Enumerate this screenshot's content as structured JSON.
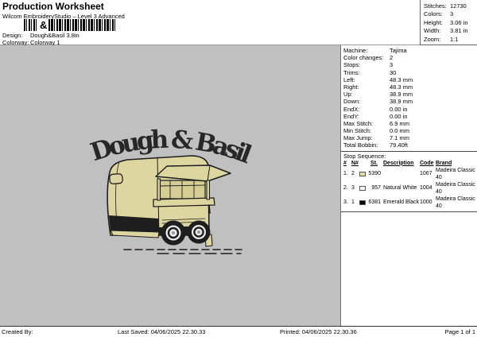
{
  "header": {
    "title": "Production Worksheet",
    "subtitle": "Wilcom EmbroideryStudio – Level 3 Advanced",
    "barcode_text": "&",
    "design_label": "Design:",
    "design_value": "Dough&Basil 3.8in",
    "colorway_label": "Colorway:",
    "colorway_value": "Colorway 1"
  },
  "stats": {
    "rows": [
      {
        "label": "Stitches:",
        "value": "12730"
      },
      {
        "label": "Colors:",
        "value": "3"
      },
      {
        "label": "Height:",
        "value": "3.06 in"
      },
      {
        "label": "Width:",
        "value": "3.81 in"
      },
      {
        "label": "Zoom:",
        "value": "1:1"
      }
    ]
  },
  "machine_info": {
    "rows": [
      {
        "label": "Machine:",
        "value": "Tajima"
      },
      {
        "label": "Color changes:",
        "value": "2"
      },
      {
        "label": "Stops:",
        "value": "3"
      },
      {
        "label": "Trims:",
        "value": "30"
      },
      {
        "label": "Left:",
        "value": "48.3 mm"
      },
      {
        "label": "Right:",
        "value": "48.3 mm"
      },
      {
        "label": "Up:",
        "value": "38.9 mm"
      },
      {
        "label": "Down:",
        "value": "38.9 mm"
      },
      {
        "label": "EndX:",
        "value": "0.00 in"
      },
      {
        "label": "EndY:",
        "value": "0.00 in"
      },
      {
        "label": "Max Stitch:",
        "value": "6.9 mm"
      },
      {
        "label": "Min Stitch:",
        "value": "0.0 mm"
      },
      {
        "label": "Max Jump:",
        "value": "7.1 mm"
      },
      {
        "label": "Total Bobbin:",
        "value": "79.40ft"
      }
    ]
  },
  "stop_sequence": {
    "heading": "Stop Sequence:",
    "columns": [
      "#",
      "N#",
      "St.",
      "Description",
      "Code",
      "Brand"
    ],
    "rows": [
      {
        "num": "1.",
        "n": "2",
        "swatch": "#e7dd9e",
        "st": "5390",
        "description": "",
        "code": "1067",
        "brand": "Madeira Classic 40"
      },
      {
        "num": "2.",
        "n": "3",
        "swatch": "#ffffff",
        "st": "957",
        "description": "Natural White",
        "code": "1004",
        "brand": "Madeira Classic 40"
      },
      {
        "num": "3.",
        "n": "1",
        "swatch": "#000000",
        "st": "6381",
        "description": "Emerald Black",
        "code": "1000",
        "brand": "Madeira Classic 40"
      }
    ]
  },
  "design_preview": {
    "arc_text": "Dough & Basil",
    "thread_cream": "#ddd6a0",
    "thread_black": "#1e1e1e",
    "thread_white": "#ececec",
    "canvas_gray": "#c0c0c0"
  },
  "footer": {
    "created_label": "Created By:",
    "last_saved": "Last Saved: 04/06/2025 22.30.33",
    "printed": "Printed: 04/06/2025 22.30.36",
    "page": "Page 1 of 1"
  }
}
